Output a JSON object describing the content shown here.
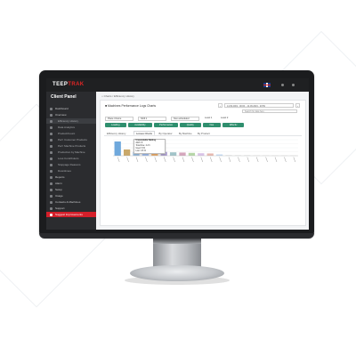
{
  "app": {
    "logo_main": "TEEP",
    "logo_accent": "TRAK",
    "panel_title": "Client Panel"
  },
  "sidebar": {
    "items": [
      {
        "label": "Dashboard",
        "kind": "main"
      },
      {
        "label": "Overview",
        "kind": "main"
      },
      {
        "label": "Efficiency History",
        "kind": "sub",
        "active": true
      },
      {
        "label": "Data Analytics",
        "kind": "sub"
      },
      {
        "label": "Product/Count",
        "kind": "sub"
      },
      {
        "label": "Perf. Customer Products",
        "kind": "sub"
      },
      {
        "label": "Perf. Machine Products",
        "kind": "sub"
      },
      {
        "label": "Production by Machine",
        "kind": "sub"
      },
      {
        "label": "Loss Contributors",
        "kind": "sub"
      },
      {
        "label": "Stoppage Reasons",
        "kind": "sub"
      },
      {
        "label": "Downtimes",
        "kind": "sub"
      },
      {
        "label": "Reports",
        "kind": "main"
      },
      {
        "label": "Alarm",
        "kind": "main"
      },
      {
        "label": "Setup",
        "kind": "main"
      },
      {
        "label": "Usage",
        "kind": "main"
      },
      {
        "label": "Contacts & Machines",
        "kind": "main"
      },
      {
        "label": "Support",
        "kind": "main"
      },
      {
        "label": "Suggest Improvements",
        "kind": "highlight"
      }
    ]
  },
  "main": {
    "breadcrumb": "⌂ Charts / Efficiency History",
    "title": "■ Machines Performance Logs Charts",
    "date_range": "14.09.2019 - 00:00 – 14.09.2019 - 23:59",
    "search_placeholder": "Search for data here",
    "select_place": "Place Choice",
    "select_shift": "Shift 1",
    "select_range": "Non-scheduled",
    "level1": "Level 1",
    "level2": "Level 2",
    "pills": [
      "Loading",
      "Availability",
      "Performance",
      "Quality",
      "Oee",
      "Effectiv"
    ],
    "tabs": [
      "Efficiency History",
      "Losses Charts",
      "By Operator",
      "By Machine",
      "By Product"
    ]
  },
  "tooltip": {
    "title": "Unavoidable Waiting",
    "lines": [
      "2015: 8",
      "Total time: 4.2 h",
      "Used: 8 %",
      "Lost: 3.5 %"
    ]
  },
  "chart_data": {
    "type": "bar",
    "categories": [
      "",
      "",
      "",
      "",
      "",
      "",
      "",
      "",
      "",
      "",
      "",
      "",
      "",
      "",
      "",
      "",
      "",
      "",
      "",
      ""
    ],
    "values": [
      1.25,
      0.55,
      0.3,
      0.35,
      0.32,
      0.33,
      0.3,
      0.28,
      0.25,
      0.22,
      0.2,
      0.12,
      0.05,
      0.04,
      0.04,
      0.03,
      0.03,
      0.02,
      0.02,
      0.02
    ],
    "colors": [
      "#6fa8dc",
      "#c9a86a",
      "#9fc5e8",
      "#a4c2f4",
      "#f6b26b",
      "#b4a7d6",
      "#a2c4c9",
      "#d5a6bd",
      "#b6d7a8",
      "#d9c3e8",
      "#e6b8af",
      "#c5dbf2",
      "#dddddd",
      "#dddddd",
      "#dddddd",
      "#dddddd",
      "#dddddd",
      "#dddddd",
      "#dddddd",
      "#dddddd"
    ],
    "ylim": [
      0,
      1.4
    ],
    "grid": true,
    "legend": "none"
  },
  "colors": {
    "accent_red": "#e02525",
    "pill_green": "#2f8f6e",
    "sidebar_bg": "#2b2c2f"
  }
}
